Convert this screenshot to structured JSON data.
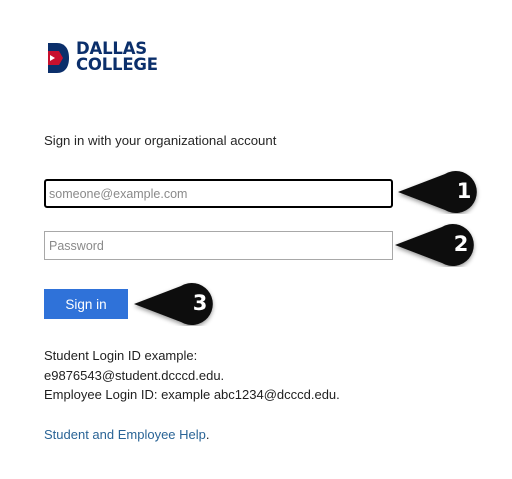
{
  "brand": {
    "line1": "DALLAS",
    "line2": "COLLEGE",
    "primary_color": "#0b2f6b",
    "accent_color": "#c8102e"
  },
  "login": {
    "prompt": "Sign in with your organizational account",
    "email_placeholder": "someone@example.com",
    "password_placeholder": "Password",
    "signin_label": "Sign in",
    "button_color": "#2f72d9"
  },
  "info": {
    "line1": "Student Login ID example:",
    "line2": "e9876543@student.dcccd.edu.",
    "line3": "Employee Login ID: example abc1234@dcccd.edu."
  },
  "help": {
    "link_text": "Student and Employee Help",
    "suffix": "."
  },
  "callouts": {
    "one": "1",
    "two": "2",
    "three": "3"
  }
}
